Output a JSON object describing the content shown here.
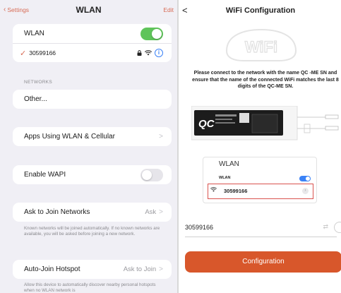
{
  "ios": {
    "nav": {
      "back_label": "Settings",
      "title": "WLAN",
      "edit_label": "Edit"
    },
    "wlan_row": {
      "label": "WLAN",
      "toggle_on": true
    },
    "connected": {
      "ssid": "30599166",
      "info_glyph": "i"
    },
    "networks_header": "NETWORKS",
    "other_label": "Other...",
    "apps_row": {
      "label": "Apps Using WLAN & Cellular",
      "chevron": ">"
    },
    "wapi_row": {
      "label": "Enable WAPI",
      "toggle_on": false
    },
    "ask_row": {
      "label": "Ask to Join Networks",
      "value": "Ask",
      "chevron": ">"
    },
    "ask_note": "Known networks will be joined automatically. If no known networks are available, you will be asked before joining a new network.",
    "autojoin_row": {
      "label": "Auto-Join Hotspot",
      "value": "Ask to Join",
      "chevron": ">"
    },
    "autojoin_note": "Allow this device to automatically discover nearby personal hotspots when no WLAN network is",
    "colors": {
      "accent": "#d86c56",
      "toggle_on": "#5fc45a",
      "background": "#f0eff5"
    }
  },
  "config": {
    "nav": {
      "back_glyph": "<",
      "title": "WiFi Configuration"
    },
    "logo_text": "WiFi",
    "instruction": "Please connect to the network with the name QC -ME SN and ensure that the name of the connected WiFi matches the last 8 digits of the QC-ME SN.",
    "device_brand": "QC",
    "illustration": {
      "title": "WLAN",
      "row_label": "WLAN",
      "ssid": "30599166"
    },
    "ssid_input_value": "30599166",
    "button_label": "Configuration",
    "colors": {
      "button": "#d8572b",
      "highlight": "#d9534f"
    }
  }
}
